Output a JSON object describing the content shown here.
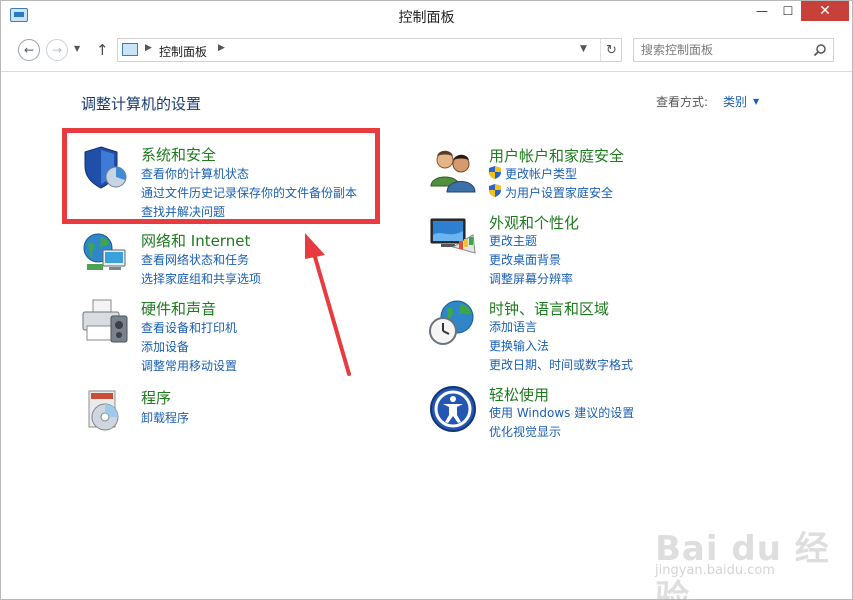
{
  "window": {
    "title": "控制面板",
    "buttons": {
      "minimize": "—",
      "maximize": "☐",
      "close": "✕"
    }
  },
  "nav": {
    "back": "←",
    "forward": "→",
    "recent": "▼",
    "up": "↑",
    "address_text": "控制面板",
    "address_sep": "▶",
    "address_dropdown": "▼",
    "refresh": "↻",
    "search_placeholder": "搜索控制面板"
  },
  "content": {
    "heading": "调整计算机的设置",
    "view_label": "查看方式:",
    "view_value": "类别",
    "view_caret": "▼"
  },
  "categories": {
    "system": {
      "title": "系统和安全",
      "links": [
        "查看你的计算机状态",
        "通过文件历史记录保存你的文件备份副本",
        "查找并解决问题"
      ],
      "icon": "shield-pie-icon"
    },
    "network": {
      "title": "网络和 Internet",
      "links": [
        "查看网络状态和任务",
        "选择家庭组和共享选项"
      ],
      "icon": "network-globe-icon"
    },
    "hardware": {
      "title": "硬件和声音",
      "links": [
        "查看设备和打印机",
        "添加设备",
        "调整常用移动设置"
      ],
      "icon": "printer-icon"
    },
    "programs": {
      "title": "程序",
      "links": [
        "卸载程序"
      ],
      "icon": "programs-disc-icon"
    },
    "users": {
      "title": "用户帐户和家庭安全",
      "links": [
        "更改帐户类型",
        "为用户设置家庭安全"
      ],
      "icon": "users-icon"
    },
    "appearance": {
      "title": "外观和个性化",
      "links": [
        "更改主题",
        "更改桌面背景",
        "调整屏幕分辨率"
      ],
      "icon": "monitor-palette-icon"
    },
    "clock": {
      "title": "时钟、语言和区域",
      "links": [
        "添加语言",
        "更换输入法",
        "更改日期、时间或数字格式"
      ],
      "icon": "clock-globe-icon"
    },
    "ease": {
      "title": "轻松使用",
      "links": [
        "使用 Windows 建议的设置",
        "优化视觉显示"
      ],
      "icon": "ease-of-access-icon"
    }
  },
  "watermark": {
    "main": "Bai du 经验",
    "sub": "jingyan.baidu.com"
  },
  "colors": {
    "category_title": "#1e7a1e",
    "link": "#1a5fb4",
    "highlight": "#e83b3f",
    "close_button": "#c7413a"
  }
}
